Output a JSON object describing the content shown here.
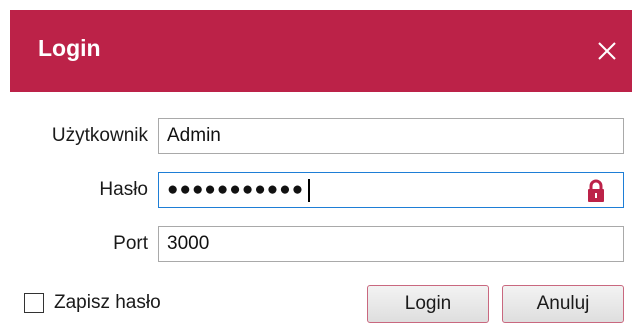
{
  "window": {
    "title": "Login",
    "accent_color": "#bc2248",
    "close_icon": "close-icon"
  },
  "form": {
    "username": {
      "label": "Użytkownik",
      "value": "Admin"
    },
    "password": {
      "label": "Hasło",
      "value_masked": "●●●●●●●●●●●",
      "icon": "lock-icon"
    },
    "port": {
      "label": "Port",
      "value": "3000"
    },
    "remember": {
      "label": "Zapisz hasło",
      "checked": false
    }
  },
  "buttons": {
    "login_label": "Login",
    "cancel_label": "Anuluj"
  }
}
